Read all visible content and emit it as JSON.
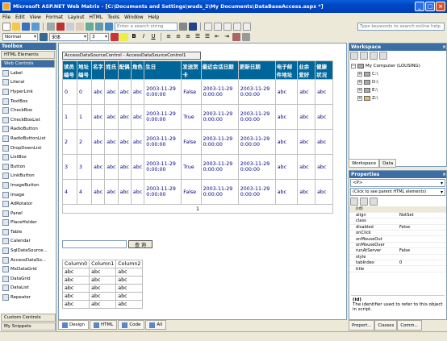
{
  "title": "Microsoft ASP.NET Web Matrix - [C:\\Documents and Settings\\wuds_2\\My Documents\\DataBaseAccess.aspx *]",
  "menu": [
    "File",
    "Edit",
    "View",
    "Format",
    "Layout",
    "HTML",
    "Tools",
    "Window",
    "Help"
  ],
  "toolbar": {
    "search_placeholder": "Enter a search string",
    "help_placeholder": "Type keywords to search online help",
    "style_value": "Normal",
    "font_value": "宋体",
    "size_value": "3"
  },
  "toolbox": {
    "title": "Toolbox",
    "categories": [
      "HTML Elements",
      "Web Controls"
    ],
    "items": [
      "Label",
      "Literal",
      "HyperLink",
      "TextBox",
      "CheckBox",
      "CheckBoxList",
      "RadioButton",
      "RadioButtonList",
      "DropDownList",
      "ListBox",
      "Button",
      "LinkButton",
      "ImageButton",
      "Image",
      "AdRotator",
      "Panel",
      "PlaceHolder",
      "Table",
      "Calendar",
      "SqlDataSource...",
      "AccessDataSo...",
      "MxDataGrid",
      "DataGrid",
      "DataList",
      "Repeater"
    ],
    "bottom": [
      "Custom Controls",
      "My Snippets"
    ]
  },
  "designer": {
    "control_header": "AccessDataSourceControl - AccessDataSourceControl1",
    "grid_headers": [
      "读员编号",
      "地址编号",
      "名字",
      "姓氏",
      "配偶",
      "角色",
      "生日",
      "发送贺卡",
      "最近会话日期",
      "更新日期",
      "电子邮件地址",
      "业余爱好",
      "健康状况"
    ],
    "grid_rows": [
      [
        "0",
        "0",
        "abc",
        "abc",
        "abc",
        "abc",
        "2003-11-29 0:00:00",
        "False",
        "2003-11-29 0:00:00",
        "2003-11-29 0:00:00",
        "abc",
        "abc",
        "abc"
      ],
      [
        "1",
        "1",
        "abc",
        "abc",
        "abc",
        "abc",
        "2003-11-29 0:00:00",
        "True",
        "2003-11-29 0:00:00",
        "2003-11-29 0:00:00",
        "abc",
        "abc",
        "abc"
      ],
      [
        "2",
        "2",
        "abc",
        "abc",
        "abc",
        "abc",
        "2003-11-29 0:00:00",
        "False",
        "2003-11-29 0:00:00",
        "2003-11-29 0:00:00",
        "abc",
        "abc",
        "abc"
      ],
      [
        "3",
        "3",
        "abc",
        "abc",
        "abc",
        "abc",
        "2003-11-29 0:00:00",
        "True",
        "2003-11-29 0:00:00",
        "2003-11-29 0:00:00",
        "abc",
        "abc",
        "abc"
      ],
      [
        "4",
        "4",
        "abc",
        "abc",
        "abc",
        "abc",
        "2003-11-29 0:00:00",
        "False",
        "2003-11-29 0:00:00",
        "2003-11-29 0:00:00",
        "abc",
        "abc",
        "abc"
      ]
    ],
    "pager": "1",
    "search_button": "查 询",
    "grid2_headers": [
      "Column0",
      "Column1",
      "Column2"
    ],
    "grid2_rows": [
      [
        "abc",
        "abc",
        "abc"
      ],
      [
        "abc",
        "abc",
        "abc"
      ],
      [
        "abc",
        "abc",
        "abc"
      ],
      [
        "abc",
        "abc",
        "abc"
      ],
      [
        "abc",
        "abc",
        "abc"
      ]
    ],
    "view_tabs": [
      "Design",
      "HTML",
      "Code",
      "All"
    ]
  },
  "workspace": {
    "title": "Workspace",
    "tree": [
      "My Computer (LOUSING)",
      "C:\\",
      "D:\\",
      "E:\\",
      "Z:\\"
    ],
    "tabs": [
      "Workspace",
      "Data"
    ]
  },
  "properties": {
    "title": "Properties",
    "selected": "<P>",
    "hint": "(Click to see parent HTML elements)",
    "rows": [
      [
        "(id)",
        ""
      ],
      [
        "align",
        "NotSet"
      ],
      [
        "class",
        ""
      ],
      [
        "disabled",
        "False"
      ],
      [
        "onClick",
        ""
      ],
      [
        "onMouseOut",
        ""
      ],
      [
        "onMouseOver",
        ""
      ],
      [
        "runAtServer",
        "False"
      ],
      [
        "style",
        ""
      ],
      [
        "tabIndex",
        "0"
      ],
      [
        "title",
        ""
      ]
    ],
    "desc_title": "(id)",
    "desc_text": "The identifier used to refer to this object in script.",
    "tabs": [
      "Propert...",
      "Classes",
      "Comm..."
    ]
  }
}
